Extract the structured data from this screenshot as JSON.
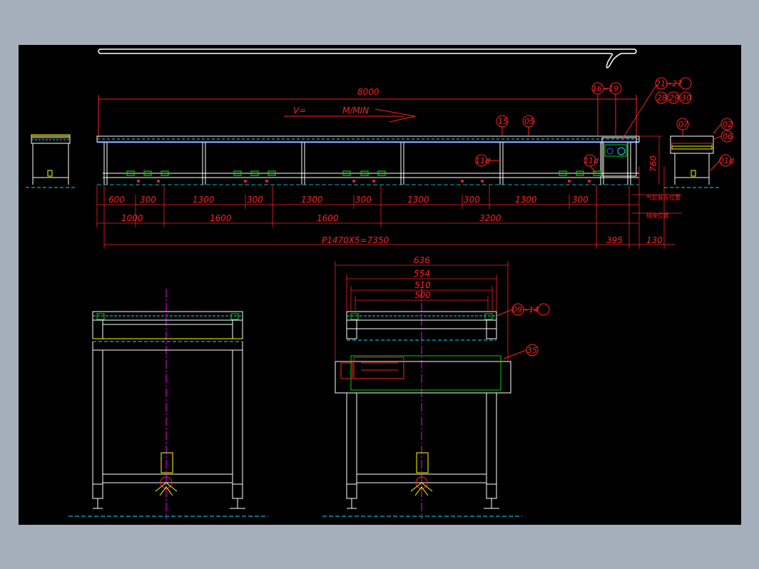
{
  "drawing": {
    "overall_length": "8000",
    "speed_label": "V=",
    "speed_unit": "M/MIN",
    "height_dim": "760",
    "lower_dims": [
      "600",
      "300",
      "1300",
      "300",
      "1300",
      "300",
      "1300",
      "300",
      "1300",
      "300"
    ],
    "pitch_dims": [
      "1000",
      "1600",
      "1600",
      "3200"
    ],
    "pitch_total": "P1470X5=7350",
    "end_dims": [
      "395",
      "130"
    ],
    "note_1": "气缸装头位置",
    "note_2": "插座位置",
    "width_dims": [
      "636",
      "554",
      "510",
      "500"
    ],
    "balloons": {
      "b15": "15",
      "b05": "05",
      "b16_19": "16~19",
      "b21_27": "21~27",
      "b28": "28",
      "b29": "29",
      "b30": "30",
      "b07": "07",
      "b02": "02",
      "b06": "06",
      "b11d_a": "11d",
      "b11d_b": "11d",
      "b01d": "01d",
      "b09_14": "09~14",
      "b35": "35"
    }
  },
  "colors": {
    "frame": "#ffffff",
    "dimension": "#ff2020",
    "centerline": "#ff00ff",
    "belt": "#00e5ff",
    "rollers": "#00d000",
    "motor": "#ff3030",
    "accent": "#ffff00"
  }
}
